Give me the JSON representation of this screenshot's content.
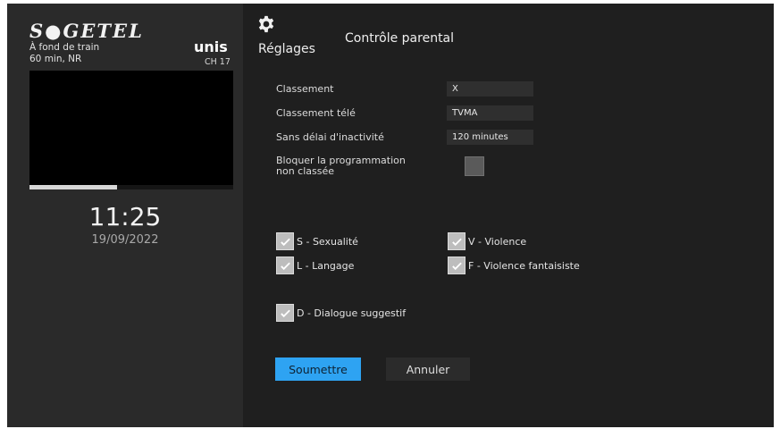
{
  "brand": {
    "name": "S●GETEL"
  },
  "now_playing": {
    "title": "À fond de train",
    "meta": "60 min, NR",
    "channel_logo": "unis",
    "channel_number": "CH 17",
    "progress": 0.43
  },
  "clock": {
    "time": "11:25",
    "date": "19/09/2022"
  },
  "header": {
    "settings_icon": "gear-icon",
    "settings_label": "Réglages",
    "title": "Contrôle parental"
  },
  "fields": {
    "rating": {
      "label": "Classement",
      "value": "X"
    },
    "tv_rating": {
      "label": "Classement télé",
      "value": "TVMA"
    },
    "timeout": {
      "label": "Sans délai d'inactivité",
      "value": "120 minutes"
    },
    "block_unrated": {
      "label_line1": "Bloquer la programmation",
      "label_line2": "non classée",
      "checked": false
    }
  },
  "content_filters": [
    {
      "label": "S - Sexualité",
      "checked": true
    },
    {
      "label": "V - Violence",
      "checked": true
    },
    {
      "label": "L - Langage",
      "checked": true
    },
    {
      "label": "F - Violence fantaisiste",
      "checked": true
    },
    {
      "label": "D - Dialogue suggestif",
      "checked": true
    }
  ],
  "buttons": {
    "submit": "Soumettre",
    "cancel": "Annuler"
  },
  "colors": {
    "accent": "#2ea3f2",
    "panel_left": "#2a2a2a",
    "panel_right": "#1f1f1f"
  }
}
